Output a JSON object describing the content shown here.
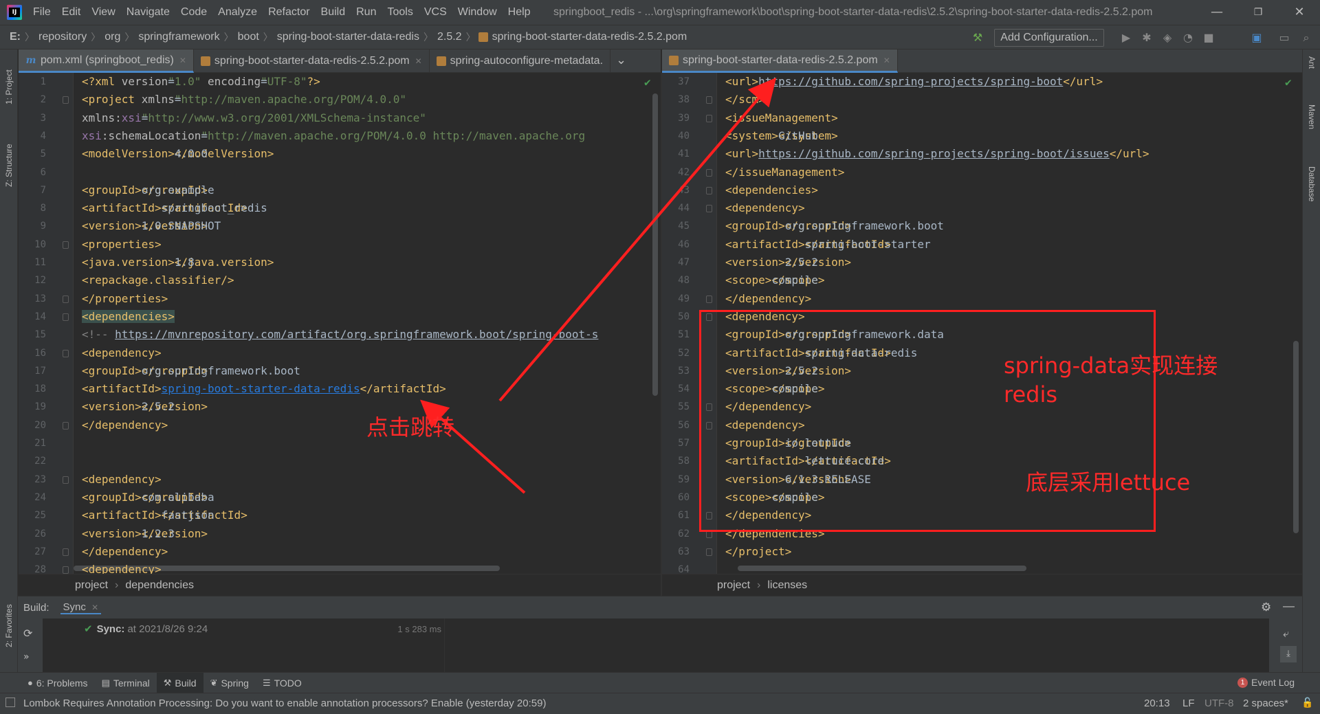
{
  "menu": [
    "File",
    "Edit",
    "View",
    "Navigate",
    "Code",
    "Analyze",
    "Refactor",
    "Build",
    "Run",
    "Tools",
    "VCS",
    "Window",
    "Help"
  ],
  "window_title": "springboot_redis - ...\\org\\springframework\\boot\\spring-boot-starter-data-redis\\2.5.2\\spring-boot-starter-data-redis-2.5.2.pom",
  "window_controls": {
    "minimize": "—",
    "restore": "❐",
    "close": "✕"
  },
  "nav": {
    "drive": "E:",
    "crumbs": [
      "repository",
      "org",
      "springframework",
      "boot",
      "spring-boot-starter-data-redis",
      "2.5.2",
      "spring-boot-starter-data-redis-2.5.2.pom"
    ],
    "add_config": "Add Configuration..."
  },
  "left_stripe": {
    "project": "1: Project",
    "structure": "Z: Structure",
    "favorites": "2: Favorites"
  },
  "right_stripe": {
    "ant": "Ant",
    "maven": "Maven",
    "database": "Database"
  },
  "left_tabs": [
    {
      "icon": "maven-m-icon",
      "label": "pom.xml (springboot_redis)"
    },
    {
      "icon": "jar-icon",
      "label": "spring-boot-starter-data-redis-2.5.2.pom"
    },
    {
      "icon": "jar-icon",
      "label": "spring-autoconfigure-metadata."
    }
  ],
  "right_tabs": [
    {
      "icon": "jar-icon",
      "label": "spring-boot-starter-data-redis-2.5.2.pom"
    }
  ],
  "left_editor": {
    "lines": [
      {
        "n": "1",
        "parts": [
          [
            "tag",
            "<?xml "
          ],
          [
            "attr",
            "version"
          ],
          [
            "code",
            "="
          ],
          [
            "val",
            "\"1.0\""
          ],
          [
            "attr",
            " encoding"
          ],
          [
            "code",
            "="
          ],
          [
            "val",
            "\"UTF-8\""
          ],
          [
            "tag",
            "?>"
          ]
        ]
      },
      {
        "n": "2",
        "parts": [
          [
            "tag",
            "<project "
          ],
          [
            "attr",
            "xmlns"
          ],
          [
            "code",
            "="
          ],
          [
            "val",
            "\"http://maven.apache.org/POM/4.0.0\""
          ]
        ]
      },
      {
        "n": "3",
        "parts": [
          [
            "code",
            "         "
          ],
          [
            "attr",
            "xmlns:"
          ],
          [
            "ns",
            "xsi"
          ],
          [
            "code",
            "="
          ],
          [
            "val",
            "\"http://www.w3.org/2001/XMLSchema-instance\""
          ]
        ]
      },
      {
        "n": "4",
        "parts": [
          [
            "code",
            "         "
          ],
          [
            "ns",
            "xsi"
          ],
          [
            "attr",
            ":schemaLocation"
          ],
          [
            "code",
            "="
          ],
          [
            "val",
            "\"http://maven.apache.org/POM/4.0.0 http://maven.apache.org"
          ]
        ]
      },
      {
        "n": "5",
        "parts": [
          [
            "code",
            "    "
          ],
          [
            "tag",
            "<modelVersion>"
          ],
          [
            "code",
            "4.0.0"
          ],
          [
            "tag",
            "</modelVersion>"
          ]
        ]
      },
      {
        "n": "6",
        "parts": []
      },
      {
        "n": "7",
        "parts": [
          [
            "code",
            "    "
          ],
          [
            "tag",
            "<groupId>"
          ],
          [
            "code",
            "org.example"
          ],
          [
            "tag",
            "</groupId>"
          ]
        ]
      },
      {
        "n": "8",
        "parts": [
          [
            "code",
            "    "
          ],
          [
            "tag",
            "<artifactId>"
          ],
          [
            "code",
            "springboot_redis"
          ],
          [
            "tag",
            "</artifactId>"
          ]
        ]
      },
      {
        "n": "9",
        "parts": [
          [
            "code",
            "    "
          ],
          [
            "tag",
            "<version>"
          ],
          [
            "code",
            "1.0-SNAPSHOT"
          ],
          [
            "tag",
            "</version>"
          ]
        ]
      },
      {
        "n": "10",
        "parts": [
          [
            "code",
            "    "
          ],
          [
            "tag",
            "<properties>"
          ]
        ]
      },
      {
        "n": "11",
        "parts": [
          [
            "code",
            "        "
          ],
          [
            "tag",
            "<java.version>"
          ],
          [
            "code",
            "1.8"
          ],
          [
            "tag",
            "</java.version>"
          ]
        ]
      },
      {
        "n": "12",
        "parts": [
          [
            "code",
            "        "
          ],
          [
            "tag",
            "<repackage.classifier/>"
          ]
        ]
      },
      {
        "n": "13",
        "parts": [
          [
            "code",
            "    "
          ],
          [
            "tag",
            "</properties>"
          ]
        ]
      },
      {
        "n": "14",
        "parts": [
          [
            "code",
            "    "
          ],
          [
            "hltag",
            "<dependencies>"
          ]
        ]
      },
      {
        "n": "15",
        "parts": [
          [
            "code",
            "        "
          ],
          [
            "cmt",
            "<!-- "
          ],
          [
            "url",
            "https://mvnrepository.com/artifact/org.springframework.boot/spring-boot-s"
          ]
        ]
      },
      {
        "n": "16",
        "parts": [
          [
            "code",
            "        "
          ],
          [
            "tag",
            "<dependency>"
          ]
        ]
      },
      {
        "n": "17",
        "parts": [
          [
            "code",
            "            "
          ],
          [
            "tag",
            "<groupId>"
          ],
          [
            "code",
            "org.springframework.boot"
          ],
          [
            "tag",
            "</groupId>"
          ]
        ]
      },
      {
        "n": "18",
        "parts": [
          [
            "code",
            "            "
          ],
          [
            "tag",
            "<artifactId>"
          ],
          [
            "link",
            "spring-boot-starter-data-redis"
          ],
          [
            "tag",
            "</artifactId>"
          ]
        ]
      },
      {
        "n": "19",
        "parts": [
          [
            "code",
            "            "
          ],
          [
            "tag",
            "<version>"
          ],
          [
            "code",
            "2.5.2"
          ],
          [
            "tag",
            "</version>"
          ]
        ]
      },
      {
        "n": "20",
        "parts": [
          [
            "code",
            "        "
          ],
          [
            "tag",
            "</dependency>"
          ]
        ]
      },
      {
        "n": "21",
        "parts": []
      },
      {
        "n": "22",
        "parts": []
      },
      {
        "n": "23",
        "parts": [
          [
            "code",
            "        "
          ],
          [
            "tag",
            "<dependency>"
          ]
        ]
      },
      {
        "n": "24",
        "parts": [
          [
            "code",
            "            "
          ],
          [
            "tag",
            "<groupId>"
          ],
          [
            "code",
            "com.alibaba"
          ],
          [
            "tag",
            "</groupId>"
          ]
        ]
      },
      {
        "n": "25",
        "parts": [
          [
            "code",
            "            "
          ],
          [
            "tag",
            "<artifactId>"
          ],
          [
            "code",
            "fastjson"
          ],
          [
            "tag",
            "</artifactId>"
          ]
        ]
      },
      {
        "n": "26",
        "parts": [
          [
            "code",
            "            "
          ],
          [
            "tag",
            "<version>"
          ],
          [
            "code",
            "1.2.3"
          ],
          [
            "tag",
            "</version>"
          ]
        ]
      },
      {
        "n": "27",
        "parts": [
          [
            "code",
            "        "
          ],
          [
            "tag",
            "</dependency>"
          ]
        ]
      },
      {
        "n": "28",
        "parts": [
          [
            "code",
            "        "
          ],
          [
            "tag",
            "<dependency>"
          ]
        ]
      }
    ],
    "breadcrumb": [
      "project",
      "dependencies"
    ]
  },
  "right_editor": {
    "lines": [
      {
        "n": "37",
        "parts": [
          [
            "code",
            "    "
          ],
          [
            "tag",
            "<url>"
          ],
          [
            "url",
            "https://github.com/spring-projects/spring-boot"
          ],
          [
            "tag",
            "</url>"
          ]
        ]
      },
      {
        "n": "38",
        "parts": [
          [
            "code",
            "  "
          ],
          [
            "tag",
            "</scm>"
          ]
        ]
      },
      {
        "n": "39",
        "parts": [
          [
            "code",
            "  "
          ],
          [
            "tag",
            "<issueManagement>"
          ]
        ]
      },
      {
        "n": "40",
        "parts": [
          [
            "code",
            "    "
          ],
          [
            "tag",
            "<system>"
          ],
          [
            "code",
            "GitHub"
          ],
          [
            "tag",
            "</system>"
          ]
        ]
      },
      {
        "n": "41",
        "parts": [
          [
            "code",
            "    "
          ],
          [
            "tag",
            "<url>"
          ],
          [
            "url",
            "https://github.com/spring-projects/spring-boot/issues"
          ],
          [
            "tag",
            "</url>"
          ]
        ]
      },
      {
        "n": "42",
        "parts": [
          [
            "code",
            "  "
          ],
          [
            "tag",
            "</issueManagement>"
          ]
        ]
      },
      {
        "n": "43",
        "parts": [
          [
            "code",
            "  "
          ],
          [
            "tag",
            "<dependencies>"
          ]
        ]
      },
      {
        "n": "44",
        "parts": [
          [
            "code",
            "    "
          ],
          [
            "tag",
            "<dependency>"
          ]
        ]
      },
      {
        "n": "45",
        "parts": [
          [
            "code",
            "      "
          ],
          [
            "tag",
            "<groupId>"
          ],
          [
            "code",
            "org.springframework.boot"
          ],
          [
            "tag",
            "</groupId>"
          ]
        ]
      },
      {
        "n": "46",
        "parts": [
          [
            "code",
            "      "
          ],
          [
            "tag",
            "<artifactId>"
          ],
          [
            "code",
            "spring-boot-starter"
          ],
          [
            "tag",
            "</artifactId>"
          ]
        ]
      },
      {
        "n": "47",
        "parts": [
          [
            "code",
            "      "
          ],
          [
            "tag",
            "<version>"
          ],
          [
            "code",
            "2.5.2"
          ],
          [
            "tag",
            "</version>"
          ]
        ]
      },
      {
        "n": "48",
        "parts": [
          [
            "code",
            "      "
          ],
          [
            "tag",
            "<scope>"
          ],
          [
            "code",
            "compile"
          ],
          [
            "tag",
            "</scope>"
          ]
        ]
      },
      {
        "n": "49",
        "parts": [
          [
            "code",
            "    "
          ],
          [
            "tag",
            "</dependency>"
          ]
        ]
      },
      {
        "n": "50",
        "parts": [
          [
            "code",
            "    "
          ],
          [
            "tag",
            "<dependency>"
          ]
        ]
      },
      {
        "n": "51",
        "parts": [
          [
            "code",
            "      "
          ],
          [
            "tag",
            "<groupId>"
          ],
          [
            "code",
            "org.springframework.data"
          ],
          [
            "tag",
            "</groupId>"
          ]
        ]
      },
      {
        "n": "52",
        "parts": [
          [
            "code",
            "      "
          ],
          [
            "tag",
            "<artifactId>"
          ],
          [
            "code",
            "spring-data-redis"
          ],
          [
            "tag",
            "</artifactId>"
          ]
        ]
      },
      {
        "n": "53",
        "parts": [
          [
            "code",
            "      "
          ],
          [
            "tag",
            "<version>"
          ],
          [
            "code",
            "2.5.2"
          ],
          [
            "tag",
            "</version>"
          ]
        ]
      },
      {
        "n": "54",
        "parts": [
          [
            "code",
            "      "
          ],
          [
            "tag",
            "<scope>"
          ],
          [
            "code",
            "compile"
          ],
          [
            "tag",
            "</scope>"
          ]
        ]
      },
      {
        "n": "55",
        "parts": [
          [
            "code",
            "    "
          ],
          [
            "tag",
            "</dependency>"
          ]
        ]
      },
      {
        "n": "56",
        "parts": [
          [
            "code",
            "    "
          ],
          [
            "tag",
            "<dependency>"
          ]
        ]
      },
      {
        "n": "57",
        "parts": [
          [
            "code",
            "      "
          ],
          [
            "tag",
            "<groupId>"
          ],
          [
            "code",
            "io.lettuce"
          ],
          [
            "tag",
            "</groupId>"
          ]
        ]
      },
      {
        "n": "58",
        "parts": [
          [
            "code",
            "      "
          ],
          [
            "tag",
            "<artifactId>"
          ],
          [
            "code",
            "lettuce-core"
          ],
          [
            "tag",
            "</artifactId>"
          ]
        ]
      },
      {
        "n": "59",
        "parts": [
          [
            "code",
            "      "
          ],
          [
            "tag",
            "<version>"
          ],
          [
            "code",
            "6.1.3.RELEASE"
          ],
          [
            "tag",
            "</version>"
          ]
        ]
      },
      {
        "n": "60",
        "parts": [
          [
            "code",
            "      "
          ],
          [
            "tag",
            "<scope>"
          ],
          [
            "code",
            "compile"
          ],
          [
            "tag",
            "</scope>"
          ]
        ]
      },
      {
        "n": "61",
        "parts": [
          [
            "code",
            "    "
          ],
          [
            "tag",
            "</dependency>"
          ]
        ]
      },
      {
        "n": "62",
        "parts": [
          [
            "code",
            "  "
          ],
          [
            "tag",
            "</dependencies>"
          ]
        ]
      },
      {
        "n": "63",
        "parts": [
          [
            "tag",
            "</project>"
          ]
        ]
      },
      {
        "n": "64",
        "parts": []
      }
    ],
    "breadcrumb": [
      "project",
      "licenses"
    ]
  },
  "build": {
    "title": "Build:",
    "tab": "Sync",
    "sync_label": "Sync:",
    "sync_time": "at 2021/8/26 9:24",
    "duration": "1 s 283 ms",
    "more": "»"
  },
  "bottom_tools": [
    {
      "icon": "problems-icon",
      "label": "6: Problems",
      "active": false
    },
    {
      "icon": "terminal-icon",
      "label": "Terminal",
      "active": false
    },
    {
      "icon": "build-icon",
      "label": "Build",
      "active": true
    },
    {
      "icon": "spring-icon",
      "label": "Spring",
      "active": false
    },
    {
      "icon": "todo-icon",
      "label": "TODO",
      "active": false
    }
  ],
  "event_log": {
    "count": "1",
    "label": "Event Log"
  },
  "status": {
    "message": "Lombok Requires Annotation Processing: Do you want to enable annotation processors? Enable (yesterday 20:59)",
    "position": "20:13",
    "line_sep": "LF",
    "encoding": "UTF-8",
    "indent": "2 spaces*"
  },
  "annotations": {
    "click_jump": "点击跳转",
    "spring_data_line1": "spring-data实现连接",
    "spring_data_line2": "redis",
    "lettuce": "底层采用lettuce"
  },
  "colors": {
    "accent": "#4a88c7",
    "annotation": "#ff1f1f",
    "tag": "#e8bf6a",
    "string": "#6a8759",
    "ok": "#499c54"
  }
}
